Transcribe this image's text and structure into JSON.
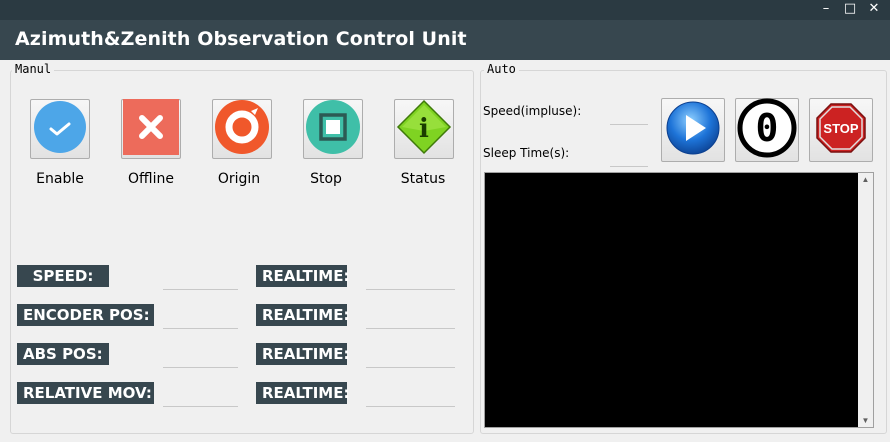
{
  "window": {
    "title": "Azimuth&Zenith Observation Control Unit",
    "controls": {
      "minimize": "–",
      "maximize": "□",
      "close": "✕"
    }
  },
  "manual": {
    "legend": "Manul",
    "buttons": [
      {
        "label": "Enable",
        "icon": "check-icon"
      },
      {
        "label": "Offline",
        "icon": "x-icon"
      },
      {
        "label": "Origin",
        "icon": "origin-icon"
      },
      {
        "label": "Stop",
        "icon": "stop-square-icon"
      },
      {
        "label": "Status",
        "icon": "info-diamond-icon"
      }
    ],
    "rows": [
      {
        "label": "SPEED:",
        "value": "",
        "realtime_label": "REALTIME:",
        "realtime_value": ""
      },
      {
        "label": "ENCODER POS:",
        "value": "",
        "realtime_label": "REALTIME:",
        "realtime_value": ""
      },
      {
        "label": "ABS POS:",
        "value": "",
        "realtime_label": "REALTIME:",
        "realtime_value": ""
      },
      {
        "label": "RELATIVE MOV:",
        "value": "",
        "realtime_label": "REALTIME:",
        "realtime_value": ""
      }
    ]
  },
  "auto": {
    "legend": "Auto",
    "speed_label": "Speed(impluse):",
    "speed_value": "",
    "sleep_label": "Sleep Time(s):",
    "sleep_value": "",
    "buttons": [
      {
        "icon": "play-icon"
      },
      {
        "icon": "zero-icon",
        "glyph": "0"
      },
      {
        "icon": "stop-sign-icon",
        "text": "STOP"
      }
    ],
    "console_text": ""
  },
  "colors": {
    "header_bg": "#37474f",
    "titlebar_bg": "#2b3a42",
    "label_bg": "#37474f",
    "enable_blue": "#4da6e8",
    "offline_red": "#ed6b5b",
    "origin_orange": "#f0582b",
    "stop_teal": "#3fbfa8",
    "status_green": "#7fd322",
    "play_blue": "#1e74d8",
    "stop_sign_red": "#cc2222"
  }
}
